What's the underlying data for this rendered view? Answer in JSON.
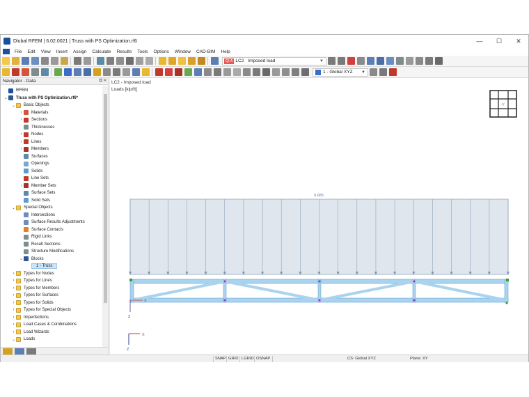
{
  "window": {
    "title": "Dlubal RFEM | 6.02.0021 | Truss with PS Optimization.rf6",
    "minimize": "—",
    "maximize": "☐",
    "close": "✕"
  },
  "menu": [
    "File",
    "Edit",
    "View",
    "Insert",
    "Assign",
    "Calculate",
    "Results",
    "Tools",
    "Options",
    "Window",
    "CAD-BIM",
    "Help"
  ],
  "toolbar": {
    "lc_tag": "Ql A",
    "lc_code": "LC2",
    "lc_name": "Imposed load",
    "cs_label": "1 - Global XYZ"
  },
  "navigator": {
    "title": "Navigator - Data",
    "header_buttons": "⧉ ✕",
    "tree": [
      {
        "label": "RFEM",
        "level": 0,
        "exp": "",
        "icon": "rfem-icon",
        "color": "#1c4f9c"
      },
      {
        "label": "Truss with PS Optimization.rf6*",
        "level": 0,
        "exp": "⌄",
        "icon": "model-icon",
        "color": "#2f5597",
        "bold": true
      },
      {
        "label": "Basic Objects",
        "level": 1,
        "exp": "⌄",
        "icon": "folder-icon",
        "folder": true
      },
      {
        "label": "Materials",
        "level": 2,
        "exp": "›",
        "icon": "materials-icon",
        "color": "#d4553a"
      },
      {
        "label": "Sections",
        "level": 2,
        "exp": "›",
        "icon": "sections-icon",
        "color": "#c0392b"
      },
      {
        "label": "Thicknesses",
        "level": 2,
        "exp": "",
        "icon": "thicknesses-icon",
        "color": "#7f8c8d"
      },
      {
        "label": "Nodes",
        "level": 2,
        "exp": "›",
        "icon": "nodes-icon",
        "color": "#c0392b"
      },
      {
        "label": "Lines",
        "level": 2,
        "exp": "›",
        "icon": "lines-icon",
        "color": "#c0392b"
      },
      {
        "label": "Members",
        "level": 2,
        "exp": "›",
        "icon": "members-icon",
        "color": "#a93226"
      },
      {
        "label": "Surfaces",
        "level": 2,
        "exp": "",
        "icon": "surfaces-icon",
        "color": "#5d8aa8"
      },
      {
        "label": "Openings",
        "level": 2,
        "exp": "",
        "icon": "openings-icon",
        "color": "#7fa7c9"
      },
      {
        "label": "Solids",
        "level": 2,
        "exp": "",
        "icon": "solids-icon",
        "color": "#5b9bd5"
      },
      {
        "label": "Line Sets",
        "level": 2,
        "exp": "",
        "icon": "line-sets-icon",
        "color": "#c0392b"
      },
      {
        "label": "Member Sets",
        "level": 2,
        "exp": "›",
        "icon": "member-sets-icon",
        "color": "#a93226"
      },
      {
        "label": "Surface Sets",
        "level": 2,
        "exp": "",
        "icon": "surface-sets-icon",
        "color": "#5d8aa8"
      },
      {
        "label": "Solid Sets",
        "level": 2,
        "exp": "",
        "icon": "solid-sets-icon",
        "color": "#5b9bd5"
      },
      {
        "label": "Special Objects",
        "level": 1,
        "exp": "⌄",
        "icon": "folder-icon",
        "folder": true
      },
      {
        "label": "Intersections",
        "level": 2,
        "exp": "",
        "icon": "intersections-icon",
        "color": "#6c8ebf"
      },
      {
        "label": "Surface Results Adjustments",
        "level": 2,
        "exp": "",
        "icon": "results-adjust-icon",
        "color": "#6c8ebf"
      },
      {
        "label": "Surface Contacts",
        "level": 2,
        "exp": "",
        "icon": "surface-contacts-icon",
        "color": "#e67e22"
      },
      {
        "label": "Rigid Links",
        "level": 2,
        "exp": "",
        "icon": "rigid-links-icon",
        "color": "#7f8c8d"
      },
      {
        "label": "Result Sections",
        "level": 2,
        "exp": "",
        "icon": "result-sections-icon",
        "color": "#7f8c8d"
      },
      {
        "label": "Structure Modifications",
        "level": 2,
        "exp": "",
        "icon": "structure-mod-icon",
        "color": "#7f8c8d"
      },
      {
        "label": "Blocks",
        "level": 2,
        "exp": "⌄",
        "icon": "blocks-icon",
        "color": "#2f5597"
      },
      {
        "label": "1 - Truss",
        "level": 3,
        "exp": "",
        "icon": "",
        "selected": true
      },
      {
        "label": "Types for Nodes",
        "level": 1,
        "exp": "›",
        "icon": "folder-icon",
        "folder": true
      },
      {
        "label": "Types for Lines",
        "level": 1,
        "exp": "›",
        "icon": "folder-icon",
        "folder": true
      },
      {
        "label": "Types for Members",
        "level": 1,
        "exp": "›",
        "icon": "folder-icon",
        "folder": true
      },
      {
        "label": "Types for Surfaces",
        "level": 1,
        "exp": "›",
        "icon": "folder-icon",
        "folder": true
      },
      {
        "label": "Types for Solids",
        "level": 1,
        "exp": "›",
        "icon": "folder-icon",
        "folder": true
      },
      {
        "label": "Types for Special Objects",
        "level": 1,
        "exp": "›",
        "icon": "folder-icon",
        "folder": true
      },
      {
        "label": "Imperfections",
        "level": 1,
        "exp": "›",
        "icon": "folder-icon",
        "folder": true
      },
      {
        "label": "Load Cases & Combinations",
        "level": 1,
        "exp": "›",
        "icon": "folder-icon",
        "folder": true
      },
      {
        "label": "Load Wizards",
        "level": 1,
        "exp": "›",
        "icon": "folder-icon",
        "folder": true
      },
      {
        "label": "Loads",
        "level": 1,
        "exp": "⌄",
        "icon": "folder-icon",
        "folder": true
      }
    ]
  },
  "viewport": {
    "load_case": "LC2 - Imposed load",
    "units": "Loads [kip/ft]",
    "load_value": "0.685",
    "axis_x": "X",
    "axis_z": "Z",
    "view_cube_label": "-Y"
  },
  "statusbar": {
    "snap": "SNAP",
    "grid": "GRID",
    "lgrid": "LGRID",
    "osnap": "OSNAP",
    "cs": "CS: Global XYZ",
    "plane": "Plane: XY"
  }
}
